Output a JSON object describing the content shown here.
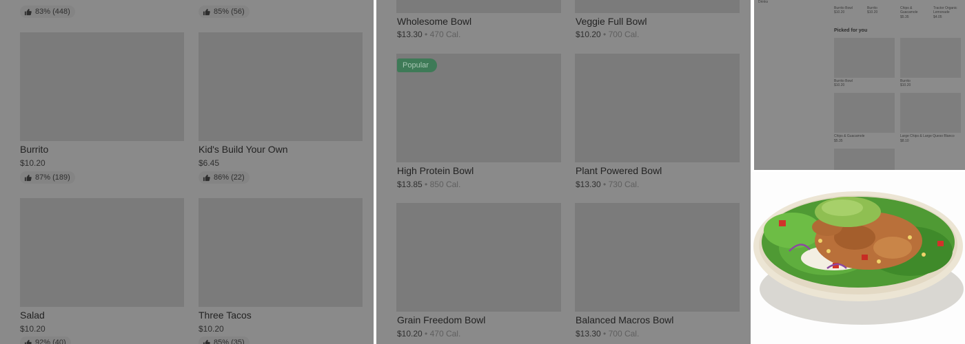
{
  "left_panel": {
    "items": [
      {
        "rating": "83% (448)"
      },
      {
        "rating": "85% (56)"
      },
      {
        "title": "Burrito",
        "price": "$10.20",
        "rating": "87% (189)"
      },
      {
        "title": "Kid's Build Your Own",
        "price": "$6.45",
        "rating": "86% (22)"
      },
      {
        "title": "Salad",
        "price": "$10.20",
        "rating": "92% (40)"
      },
      {
        "title": "Three Tacos",
        "price": "$10.20",
        "rating": "85% (35)"
      }
    ]
  },
  "middle_panel": {
    "badge": "Popular",
    "items": [
      {
        "title": "Wholesome Bowl",
        "price": "$13.30",
        "calories": "470 Cal."
      },
      {
        "title": "Veggie Full Bowl",
        "price": "$10.20",
        "calories": "700 Cal."
      },
      {
        "title": "High Protein Bowl",
        "price": "$13.85",
        "calories": "850 Cal."
      },
      {
        "title": "Plant Powered Bowl",
        "price": "$13.30",
        "calories": "730 Cal."
      },
      {
        "title": "Grain Freedom Bowl",
        "price": "$10.20",
        "calories": "470 Cal."
      },
      {
        "title": "Balanced Macros Bowl",
        "price": "$13.30",
        "calories": "700 Cal."
      }
    ],
    "separator": "•"
  },
  "right_top_panel": {
    "sidebar_label": "Drinks",
    "top_items": [
      {
        "title": "Burrito Bowl",
        "price": "$10.20"
      },
      {
        "title": "Burrito",
        "price": "$10.20"
      },
      {
        "title": "Chips & Guacamole",
        "price": "$5.35"
      },
      {
        "title": "Tractor Organic Lemonade",
        "price": "$4.05"
      }
    ],
    "section_heading": "Picked for you",
    "picked_items": [
      {
        "title": "Burrito Bowl",
        "price": "$10.20"
      },
      {
        "title": "Burrito",
        "price": "$10.20"
      },
      {
        "title": "Chips & Guacamole",
        "price": "$5.35"
      },
      {
        "title": "Large Chips & Large Queso Blanco",
        "price": "$8.10"
      }
    ]
  },
  "photo": {
    "icon": "salad-bowl-photo",
    "colors": {
      "lettuce": "#4f9a34",
      "guac": "#8fbf52",
      "chicken": "#b9703a",
      "bowl": "#e9e2d2"
    }
  },
  "colors": {
    "overlay": "#8a8a8a",
    "placeholder": "#7b7b7b",
    "badge": "#3e7a57"
  }
}
